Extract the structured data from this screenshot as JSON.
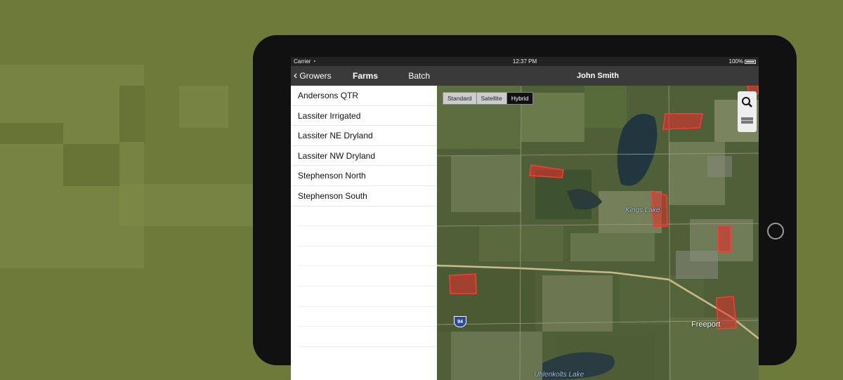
{
  "status_bar": {
    "carrier": "Carrier",
    "time": "12:37 PM",
    "battery": "100%"
  },
  "left_nav": {
    "back_label": "Growers",
    "title": "Farms",
    "batch_label": "Batch"
  },
  "farms": [
    "Andersons QTR",
    "Lassiter Irrigated",
    "Lassiter NE Dryland",
    "Lassiter NW Dryland",
    "Stephenson North",
    "Stephenson South"
  ],
  "map": {
    "title": "John Smith",
    "map_types": [
      "Standard",
      "Satellite",
      "Hybrid"
    ],
    "selected_map_type": "Hybrid",
    "labels": {
      "kings_lake": "Kings Lake",
      "freeport": "Freeport",
      "uhlenkolts_lake": "Uhlenkolts Lake",
      "highway": "94"
    }
  },
  "colors": {
    "background": "#6e7a3a",
    "field_highlight": "#e0302e",
    "nav_bar": "#3a3a3a"
  },
  "icons": {
    "back": "chevron-left-icon",
    "wifi": "wifi-icon",
    "battery": "battery-icon",
    "search": "search-icon",
    "layers": "layers-icon",
    "home": "home-button-icon"
  }
}
